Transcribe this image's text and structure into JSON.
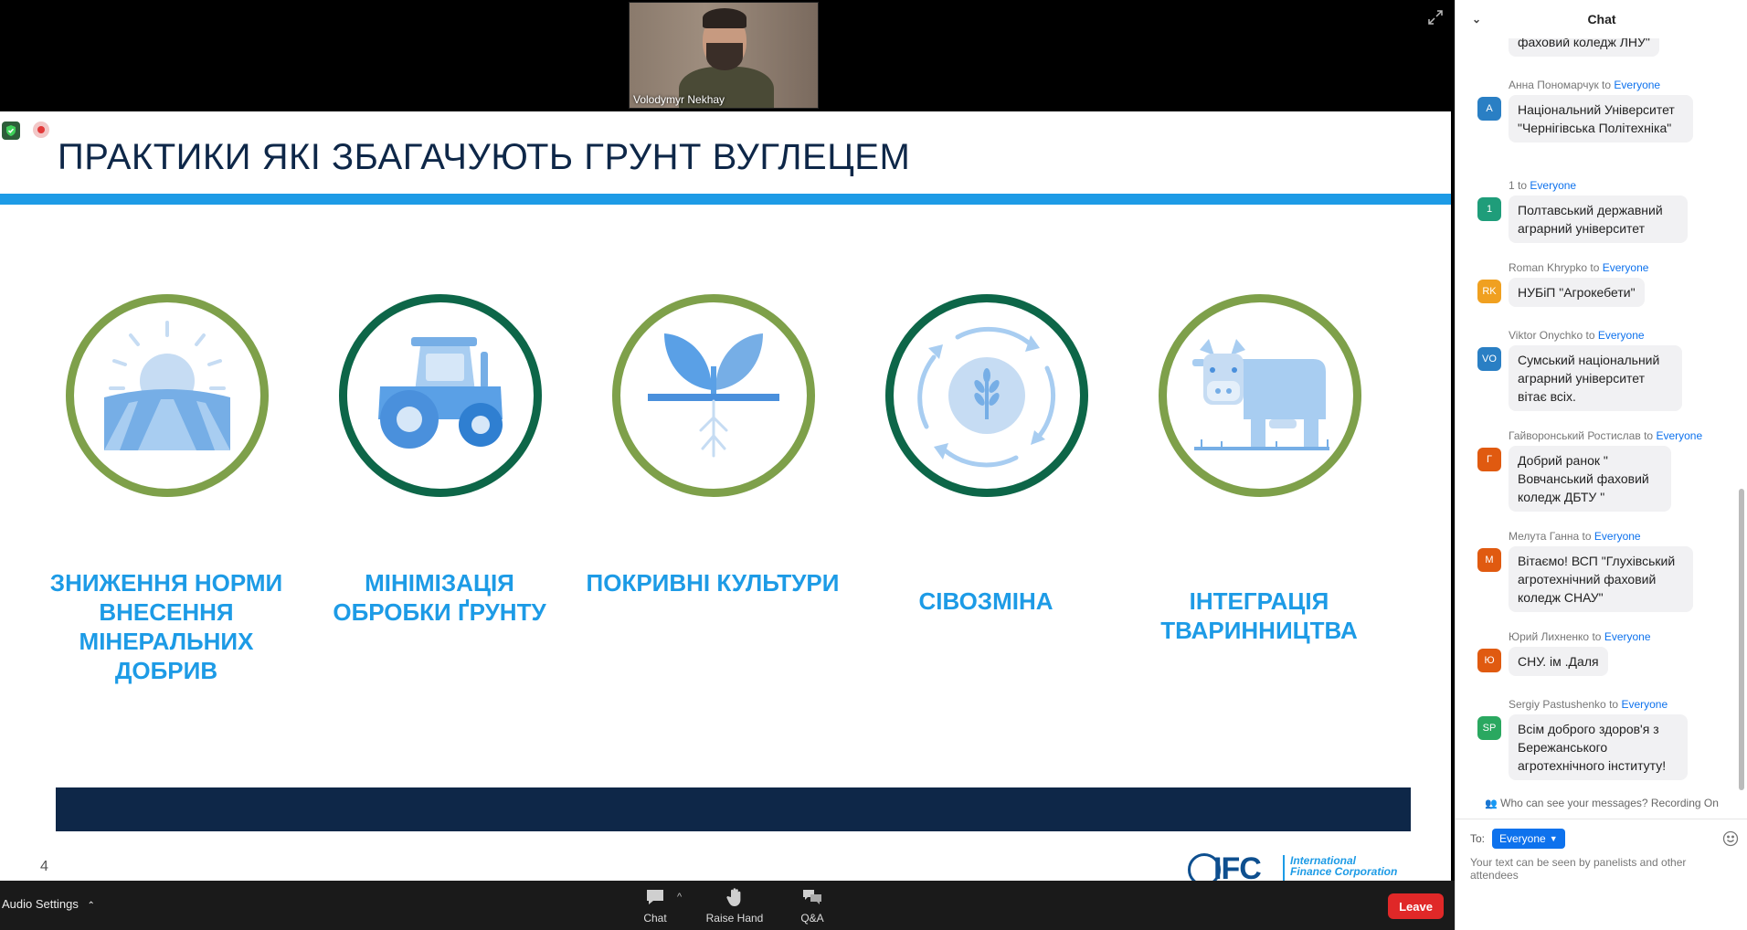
{
  "speaker": {
    "name": "Volodymyr Nekhay"
  },
  "slide": {
    "title": "ПРАКТИКИ ЯКІ ЗБАГАЧУЮТЬ ГРУНТ ВУГЛЕЦЕМ",
    "number": "4",
    "practices": [
      {
        "icon": "sun-field-icon",
        "label": "ЗНИЖЕННЯ НОРМИ ВНЕСЕННЯ МІНЕРАЛЬНИХ ДОБРИВ",
        "ring_color": "#7ea04a"
      },
      {
        "icon": "tractor-icon",
        "label": "МІНІМІЗАЦІЯ ОБРОБКИ ҐРУНТУ",
        "ring_color": "#0d6648"
      },
      {
        "icon": "sprout-icon",
        "label": "ПОКРИВНІ КУЛЬТУРИ",
        "ring_color": "#7ea04a"
      },
      {
        "icon": "crop-rotation-icon",
        "label": "СІВОЗМІНА",
        "ring_color": "#0d6648"
      },
      {
        "icon": "cow-icon",
        "label": "ІНТЕГРАЦІЯ ТВАРИННИЦТВА",
        "ring_color": "#7ea04a"
      }
    ],
    "logo": {
      "letters": "IFC",
      "name_line1": "International",
      "name_line2": "Finance Corporation"
    }
  },
  "toolbar": {
    "audio_settings": "Audio Settings",
    "chat": "Chat",
    "raise_hand": "Raise Hand",
    "qa": "Q&A",
    "leave": "Leave"
  },
  "chat": {
    "title": "Chat",
    "to_word": "to",
    "messages": [
      {
        "sender": "",
        "target": "",
        "avatar": "",
        "avatar_color": "",
        "text": "фаховий коледж ЛНУ\""
      },
      {
        "sender": "Анна Пономарчук",
        "target": "Everyone",
        "avatar": "А",
        "avatar_color": "#2a7fc4",
        "text": "Національний Університет \"Чернігівська Політехніка\""
      },
      {
        "sender": "1",
        "target": "Everyone",
        "avatar": "1",
        "avatar_color": "#1f9d7a",
        "text": "Полтавський державний аграрний університет"
      },
      {
        "sender": "Roman Khrypko",
        "target": "Everyone",
        "avatar": "RK",
        "avatar_color": "#f0a020",
        "text": "НУБіП \"Агрокебети\""
      },
      {
        "sender": "Viktor Onychko",
        "target": "Everyone",
        "avatar": "VO",
        "avatar_color": "#2a7fc4",
        "text": "Сумський національний аграрний університет вітає всіх."
      },
      {
        "sender": "Гайворонський Ростислав",
        "target": "Everyone",
        "avatar": "Г",
        "avatar_color": "#e05a10",
        "text": "Добрий ранок \" Вовчанський фаховий коледж ДБТУ \""
      },
      {
        "sender": "Мелута Ганна",
        "target": "Everyone",
        "avatar": "М",
        "avatar_color": "#e05a10",
        "text": "Вітаємо! ВСП \"Глухівський агротехнічний фаховий коледж СНАУ\""
      },
      {
        "sender": "Юрий Лихненко",
        "target": "Everyone",
        "avatar": "Ю",
        "avatar_color": "#e05a10",
        "text": "СНУ. ім .Даля"
      },
      {
        "sender": "Sergiy Pastushenko",
        "target": "Everyone",
        "avatar": "SP",
        "avatar_color": "#2aa860",
        "text": "Всім доброго здоров'я з Бережанського агротехнічного інституту!"
      }
    ],
    "privacy_note": "Who can see your messages? Recording On",
    "to_label": "To:",
    "to_value": "Everyone",
    "input_placeholder": "Your text can be seen by panelists and other attendees"
  }
}
